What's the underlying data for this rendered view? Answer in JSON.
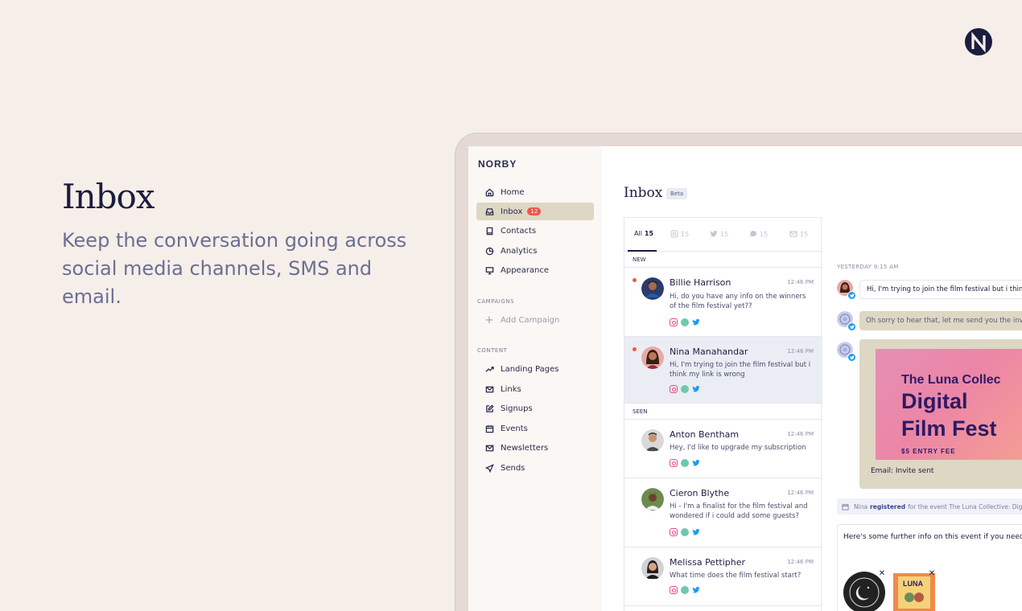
{
  "hero": {
    "title": "Inbox",
    "description": "Keep the conversation going across social media channels, SMS and email."
  },
  "colors": {
    "background": "#f6eee9",
    "navy": "#1b1d3f",
    "accent_red": "#f0544f",
    "selected_nav": "#ddd7c4",
    "selected_row": "#eaedf4"
  },
  "app": {
    "logo": "NORBY",
    "sidebar": {
      "items": [
        {
          "label": "Home",
          "icon": "home-icon"
        },
        {
          "label": "Inbox",
          "icon": "inbox-icon",
          "badge": "12",
          "active": true
        },
        {
          "label": "Contacts",
          "icon": "book-icon"
        },
        {
          "label": "Analytics",
          "icon": "pie-chart-icon"
        },
        {
          "label": "Appearance",
          "icon": "monitor-icon"
        }
      ],
      "campaigns_heading": "CAMPAIGNS",
      "add_campaign": "Add Campaign",
      "content_heading": "CONTENT",
      "content_items": [
        {
          "label": "Landing Pages",
          "icon": "trending-icon"
        },
        {
          "label": "Links",
          "icon": "mail-icon"
        },
        {
          "label": "Signups",
          "icon": "edit-icon"
        },
        {
          "label": "Events",
          "icon": "calendar-icon"
        },
        {
          "label": "Newsletters",
          "icon": "mail-icon"
        },
        {
          "label": "Sends",
          "icon": "send-icon"
        }
      ]
    },
    "inbox": {
      "title": "Inbox",
      "beta": "Beta",
      "tabs": [
        {
          "label": "All",
          "count": "15",
          "active": true
        },
        {
          "label": "",
          "icon": "instagram-icon",
          "count": "15"
        },
        {
          "label": "",
          "icon": "twitter-icon",
          "count": "15"
        },
        {
          "label": "",
          "icon": "sms-icon",
          "count": "15"
        },
        {
          "label": "",
          "icon": "mail-icon",
          "count": "15"
        }
      ],
      "new_label": "NEW",
      "seen_label": "SEEN",
      "conversations": [
        {
          "name": "Billie Harrison",
          "time": "12:46 PM",
          "preview": "Hi, do you have any info on the winners of the film festival yet??",
          "unread": true
        },
        {
          "name": "Nina Manahandar",
          "time": "12:46 PM",
          "preview": "Hi, I'm trying to join the film festival but i think my link is wrong",
          "unread": true,
          "selected": true
        },
        {
          "name": "Anton Bentham",
          "time": "12:46 PM",
          "preview": "Hey, I'd like to upgrade my subscription",
          "unread": false
        },
        {
          "name": "Cieron Blythe",
          "time": "12:46 PM",
          "preview": "Hi - I'm a finalist for the film festival and wondered if i could add some guests?",
          "unread": false
        },
        {
          "name": "Melissa Pettipher",
          "time": "12:46 PM",
          "preview": "What time does the film festival start?",
          "unread": false
        }
      ]
    },
    "chat": {
      "date_label": "YESTERDAY 9:15 AM",
      "messages": [
        {
          "direction": "in",
          "text": "Hi, I'm trying to join the film festival but i think m"
        },
        {
          "direction": "out",
          "text": "Oh sorry to hear that, let me send you the invite"
        }
      ],
      "poster": {
        "line1": "The Luna Collec",
        "line2": "Digital",
        "line3": "Film Fest",
        "line4": "$5 ENTRY FEE"
      },
      "card_caption": "Email: Invite sent",
      "event_note": {
        "name": "Nina",
        "action": "registered",
        "rest": "for the event The Luna Collective: Digita"
      },
      "compose_text": "Here's some further info on this event if you need it!"
    }
  }
}
